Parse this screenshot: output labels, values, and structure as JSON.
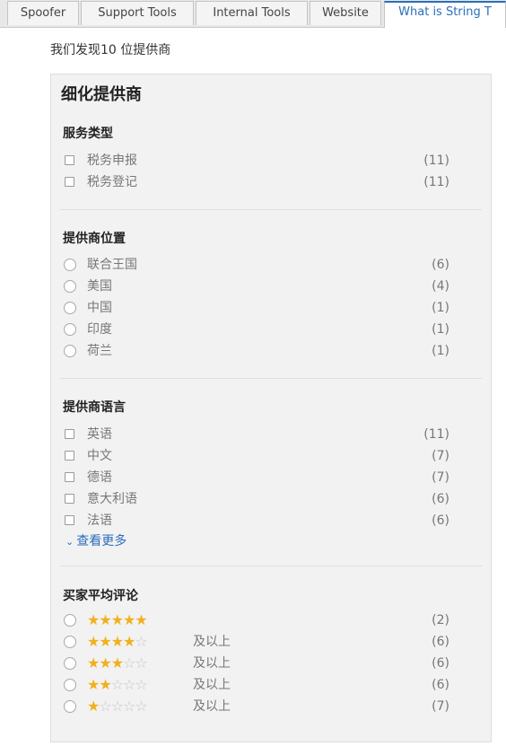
{
  "tabs": [
    {
      "label": "Spoofer"
    },
    {
      "label": "Support Tools"
    },
    {
      "label": "Internal Tools"
    },
    {
      "label": "Website"
    },
    {
      "label": "What is String T"
    }
  ],
  "result_text": "我们发现10 位提供商",
  "panel_title": "细化提供商",
  "sections": {
    "service_type": {
      "title": "服务类型",
      "items": [
        {
          "label": "税务申报",
          "count": "(11)"
        },
        {
          "label": "税务登记",
          "count": "(11)"
        }
      ]
    },
    "location": {
      "title": "提供商位置",
      "items": [
        {
          "label": "联合王国",
          "count": "(6)"
        },
        {
          "label": "美国",
          "count": "(4)"
        },
        {
          "label": "中国",
          "count": "(1)"
        },
        {
          "label": "印度",
          "count": "(1)"
        },
        {
          "label": "荷兰",
          "count": "(1)"
        }
      ]
    },
    "language": {
      "title": "提供商语言",
      "items": [
        {
          "label": "英语",
          "count": "(11)"
        },
        {
          "label": "中文",
          "count": "(7)"
        },
        {
          "label": "德语",
          "count": "(7)"
        },
        {
          "label": "意大利语",
          "count": "(6)"
        },
        {
          "label": "法语",
          "count": "(6)"
        }
      ],
      "see_more": "查看更多"
    },
    "rating": {
      "title": "买家平均评论",
      "items": [
        {
          "stars": 5,
          "suffix": "",
          "count": "(2)"
        },
        {
          "stars": 4,
          "suffix": "及以上",
          "count": "(6)"
        },
        {
          "stars": 3,
          "suffix": "及以上",
          "count": "(6)"
        },
        {
          "stars": 2,
          "suffix": "及以上",
          "count": "(6)"
        },
        {
          "stars": 1,
          "suffix": "及以上",
          "count": "(7)"
        }
      ]
    }
  },
  "colors": {
    "accent": "#2a6ebb",
    "star_filled": "#f2b01e",
    "star_empty": "#c7c7c7"
  }
}
